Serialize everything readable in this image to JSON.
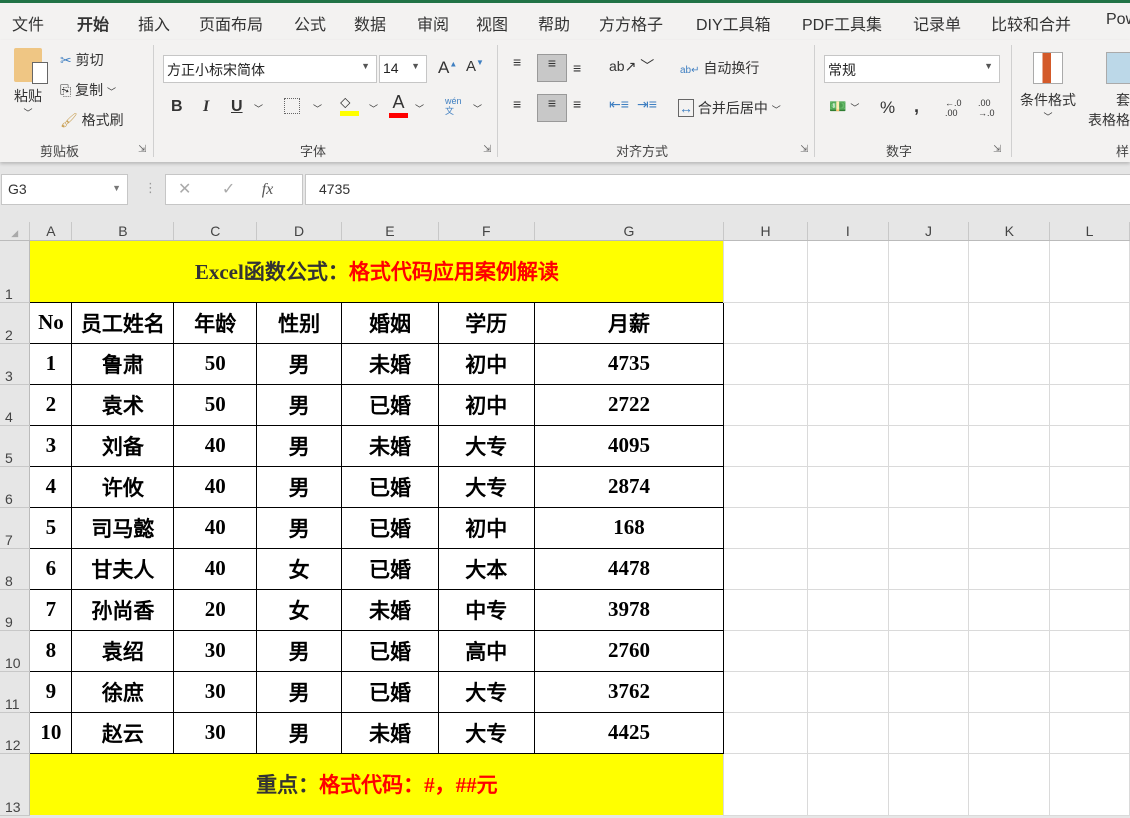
{
  "tabs": [
    "文件",
    "开始",
    "插入",
    "页面布局",
    "公式",
    "数据",
    "审阅",
    "视图",
    "帮助",
    "方方格子",
    "DIY工具箱",
    "PDF工具集",
    "记录单",
    "比较和合并",
    "Pow"
  ],
  "active_tab": "开始",
  "clipboard": {
    "paste": "粘贴",
    "cut": "剪切",
    "copy": "复制",
    "format_painter": "格式刷",
    "label": "剪贴板"
  },
  "font": {
    "name": "方正小标宋简体",
    "size": "14",
    "bold": "B",
    "italic": "I",
    "underline": "U",
    "phonetic": "wén文",
    "label": "字体",
    "fill_color": "#ffff00",
    "font_color": "#ff0000"
  },
  "alignment": {
    "wrap": "自动换行",
    "merge": "合并后居中",
    "label": "对齐方式"
  },
  "number": {
    "format": "常规",
    "percent": "%",
    "comma": ",",
    "label": "数字"
  },
  "styles": {
    "conditional": "条件格式",
    "table_format_1": "套用",
    "table_format_2": "表格格式",
    "label": "样"
  },
  "formula_bar": {
    "name_box": "G3",
    "fx": "fx",
    "value": "4735"
  },
  "columns": [
    "A",
    "B",
    "C",
    "D",
    "E",
    "F",
    "G",
    "H",
    "I",
    "J",
    "K",
    "L"
  ],
  "title": {
    "black": "Excel函数公式：",
    "red": "格式代码应用案例解读"
  },
  "headers": [
    "No",
    "员工姓名",
    "年龄",
    "性别",
    "婚姻",
    "学历",
    "月薪"
  ],
  "rows": [
    [
      "1",
      "鲁肃",
      "50",
      "男",
      "未婚",
      "初中",
      "4735"
    ],
    [
      "2",
      "袁术",
      "50",
      "男",
      "已婚",
      "初中",
      "2722"
    ],
    [
      "3",
      "刘备",
      "40",
      "男",
      "未婚",
      "大专",
      "4095"
    ],
    [
      "4",
      "许攸",
      "40",
      "男",
      "已婚",
      "大专",
      "2874"
    ],
    [
      "5",
      "司马懿",
      "40",
      "男",
      "已婚",
      "初中",
      "168"
    ],
    [
      "6",
      "甘夫人",
      "40",
      "女",
      "已婚",
      "大本",
      "4478"
    ],
    [
      "7",
      "孙尚香",
      "20",
      "女",
      "未婚",
      "中专",
      "3978"
    ],
    [
      "8",
      "袁绍",
      "30",
      "男",
      "已婚",
      "高中",
      "2760"
    ],
    [
      "9",
      "徐庶",
      "30",
      "男",
      "已婚",
      "大专",
      "3762"
    ],
    [
      "10",
      "赵云",
      "30",
      "男",
      "未婚",
      "大专",
      "4425"
    ]
  ],
  "note": {
    "black": "重点：",
    "red": "格式代码：#，##元"
  }
}
